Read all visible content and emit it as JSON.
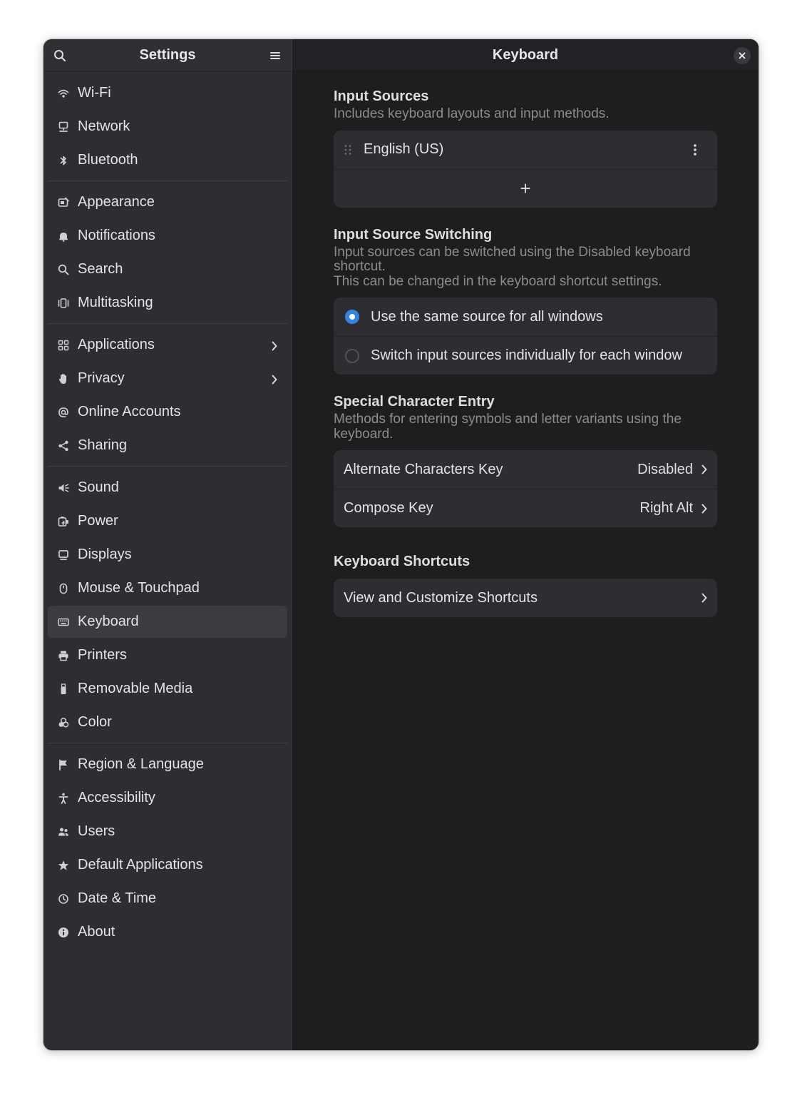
{
  "sidebar": {
    "title": "Settings",
    "groups": [
      [
        {
          "label": "Wi-Fi",
          "icon": "wifi-icon"
        },
        {
          "label": "Network",
          "icon": "network-icon"
        },
        {
          "label": "Bluetooth",
          "icon": "bluetooth-icon"
        }
      ],
      [
        {
          "label": "Appearance",
          "icon": "appearance-icon"
        },
        {
          "label": "Notifications",
          "icon": "bell-icon"
        },
        {
          "label": "Search",
          "icon": "search-icon"
        },
        {
          "label": "Multitasking",
          "icon": "multitasking-icon"
        }
      ],
      [
        {
          "label": "Applications",
          "icon": "applications-icon",
          "chevron": true
        },
        {
          "label": "Privacy",
          "icon": "hand-icon",
          "chevron": true
        },
        {
          "label": "Online Accounts",
          "icon": "at-icon"
        },
        {
          "label": "Sharing",
          "icon": "share-icon"
        }
      ],
      [
        {
          "label": "Sound",
          "icon": "speaker-icon"
        },
        {
          "label": "Power",
          "icon": "power-icon"
        },
        {
          "label": "Displays",
          "icon": "display-icon"
        },
        {
          "label": "Mouse & Touchpad",
          "icon": "mouse-icon"
        },
        {
          "label": "Keyboard",
          "icon": "keyboard-icon",
          "selected": true
        },
        {
          "label": "Printers",
          "icon": "printer-icon"
        },
        {
          "label": "Removable Media",
          "icon": "usb-icon"
        },
        {
          "label": "Color",
          "icon": "color-icon"
        }
      ],
      [
        {
          "label": "Region & Language",
          "icon": "flag-icon"
        },
        {
          "label": "Accessibility",
          "icon": "accessibility-icon"
        },
        {
          "label": "Users",
          "icon": "users-icon"
        },
        {
          "label": "Default Applications",
          "icon": "star-icon"
        },
        {
          "label": "Date & Time",
          "icon": "clock-icon"
        },
        {
          "label": "About",
          "icon": "info-icon"
        }
      ]
    ]
  },
  "content": {
    "title": "Keyboard",
    "input_sources": {
      "title": "Input Sources",
      "desc": "Includes keyboard layouts and input methods.",
      "source": "English (US)",
      "add_label": "+"
    },
    "switching": {
      "title": "Input Source Switching",
      "desc_line1": "Input sources can be switched using the Disabled keyboard shortcut.",
      "desc_line2": "This can be changed in the keyboard shortcut settings.",
      "option1": "Use the same source for all windows",
      "option2": "Switch input sources individually for each window",
      "selected": 0
    },
    "special": {
      "title": "Special Character Entry",
      "desc": "Methods for entering symbols and letter variants using the keyboard.",
      "alt_label": "Alternate Characters Key",
      "alt_value": "Disabled",
      "compose_label": "Compose Key",
      "compose_value": "Right Alt"
    },
    "shortcuts": {
      "title": "Keyboard Shortcuts",
      "view_label": "View and Customize Shortcuts"
    }
  },
  "colors": {
    "accent": "#3584e4",
    "sidebar_bg": "#2e2e32",
    "content_bg": "#1e1e1e",
    "card_bg": "#2e2e32"
  }
}
